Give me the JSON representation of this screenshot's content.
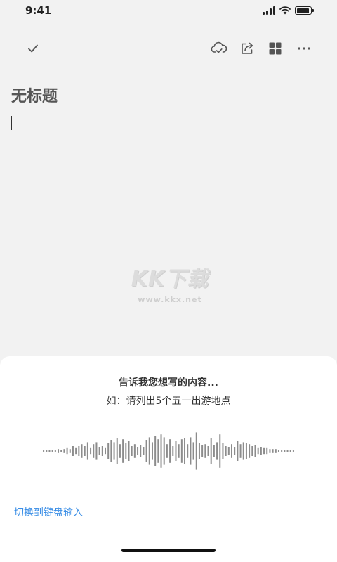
{
  "status_bar": {
    "time": "9:41",
    "signal_icon": "cellular-signal-icon",
    "wifi_icon": "wifi-icon",
    "battery_icon": "battery-icon",
    "battery_level": 0.9
  },
  "toolbar": {
    "left": [
      {
        "name": "done-button",
        "icon": "checkmark-icon"
      }
    ],
    "right": [
      {
        "name": "cloud-sync-button",
        "icon": "cloud-check-icon"
      },
      {
        "name": "share-button",
        "icon": "share-icon"
      },
      {
        "name": "templates-button",
        "icon": "grid-icon"
      },
      {
        "name": "more-button",
        "icon": "more-dots-icon"
      }
    ]
  },
  "editor": {
    "title_placeholder": "无标题"
  },
  "watermark": {
    "logo_text": "KK下载",
    "url": "www.kkx.net"
  },
  "voice_input": {
    "prompt_title": "告诉我您想写的内容...",
    "prompt_example": "如：请列出5个五一出游地点",
    "waveform_levels": [
      0.05,
      0.05,
      0.05,
      0.05,
      0.05,
      0.1,
      0.05,
      0.1,
      0.15,
      0.1,
      0.25,
      0.15,
      0.25,
      0.35,
      0.25,
      0.45,
      0.15,
      0.35,
      0.45,
      0.2,
      0.25,
      0.15,
      0.4,
      0.55,
      0.45,
      0.65,
      0.35,
      0.6,
      0.4,
      0.5,
      0.25,
      0.35,
      0.2,
      0.3,
      0.2,
      0.55,
      0.7,
      0.45,
      0.75,
      0.6,
      0.85,
      0.7,
      0.35,
      0.6,
      0.25,
      0.5,
      0.35,
      0.6,
      0.65,
      0.35,
      0.7,
      0.45,
      0.95,
      0.4,
      0.3,
      0.35,
      0.25,
      0.65,
      0.3,
      0.45,
      0.85,
      0.4,
      0.25,
      0.2,
      0.35,
      0.2,
      0.5,
      0.35,
      0.45,
      0.4,
      0.35,
      0.25,
      0.3,
      0.15,
      0.2,
      0.15,
      0.15,
      0.1,
      0.1,
      0.1,
      0.05,
      0.05,
      0.05,
      0.05,
      0.05,
      0.05
    ],
    "switch_keyboard_label": "切换到键盘输入"
  }
}
